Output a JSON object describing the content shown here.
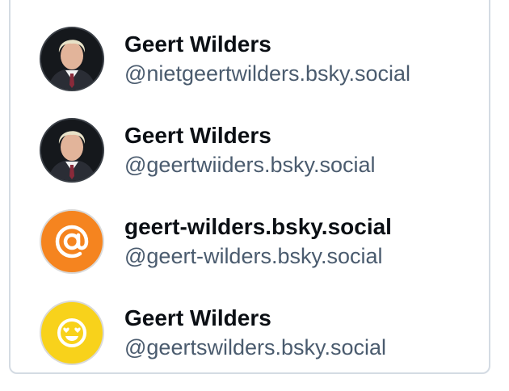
{
  "results": [
    {
      "avatar_icon": "person-photo-icon",
      "display_name": "Geert Wilders",
      "handle": "@nietgeertwilders.bsky.social"
    },
    {
      "avatar_icon": "person-photo-icon",
      "display_name": "Geert Wilders",
      "handle": "@geertwiiders.bsky.social"
    },
    {
      "avatar_icon": "at-sign-icon",
      "avatar_color": "#f5841f",
      "display_name": "geert-wilders.bsky.social",
      "handle": "@geert-wilders.bsky.social"
    },
    {
      "avatar_icon": "smiley-heart-eyes-icon",
      "avatar_color": "#f8d21b",
      "display_name": "Geert Wilders",
      "handle": "@geertswilders.bsky.social"
    }
  ]
}
